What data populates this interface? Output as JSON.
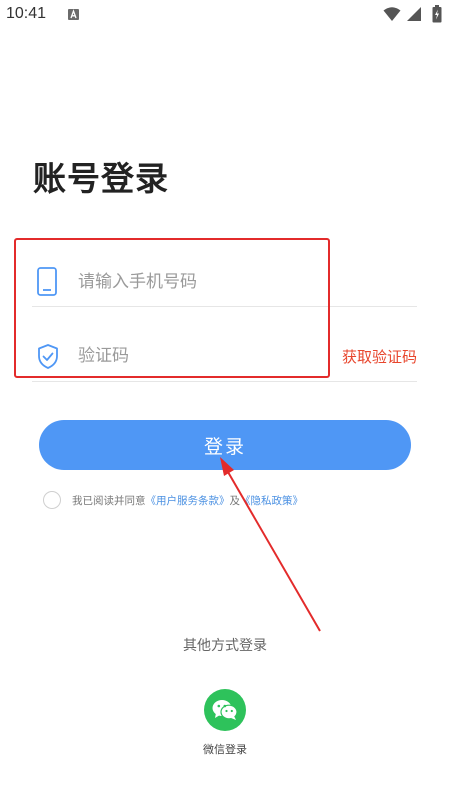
{
  "status_bar": {
    "time": "10:41",
    "icons": [
      "notification-a-icon",
      "wifi-icon",
      "signal-icon",
      "battery-icon"
    ]
  },
  "title": "账号登录",
  "form": {
    "phone_placeholder": "请输入手机号码",
    "code_placeholder": "验证码",
    "get_code_label": "获取验证码",
    "phone_icon": "phone-icon",
    "code_icon": "shield-check-icon"
  },
  "login_button_label": "登录",
  "agreement": {
    "prefix": "我已阅读并同意",
    "terms_link": "《用户服务条款》",
    "conjunction": "及",
    "privacy_link": "《隐私政策》"
  },
  "other_login": {
    "heading": "其他方式登录",
    "wechat_label": "微信登录",
    "wechat_icon": "wechat-icon"
  },
  "colors": {
    "primary": "#4f97f5",
    "accent_red": "#e8452c",
    "highlight_red": "#e32b2b",
    "wechat_green": "#2ec25b",
    "link_blue": "#4a90e2"
  }
}
